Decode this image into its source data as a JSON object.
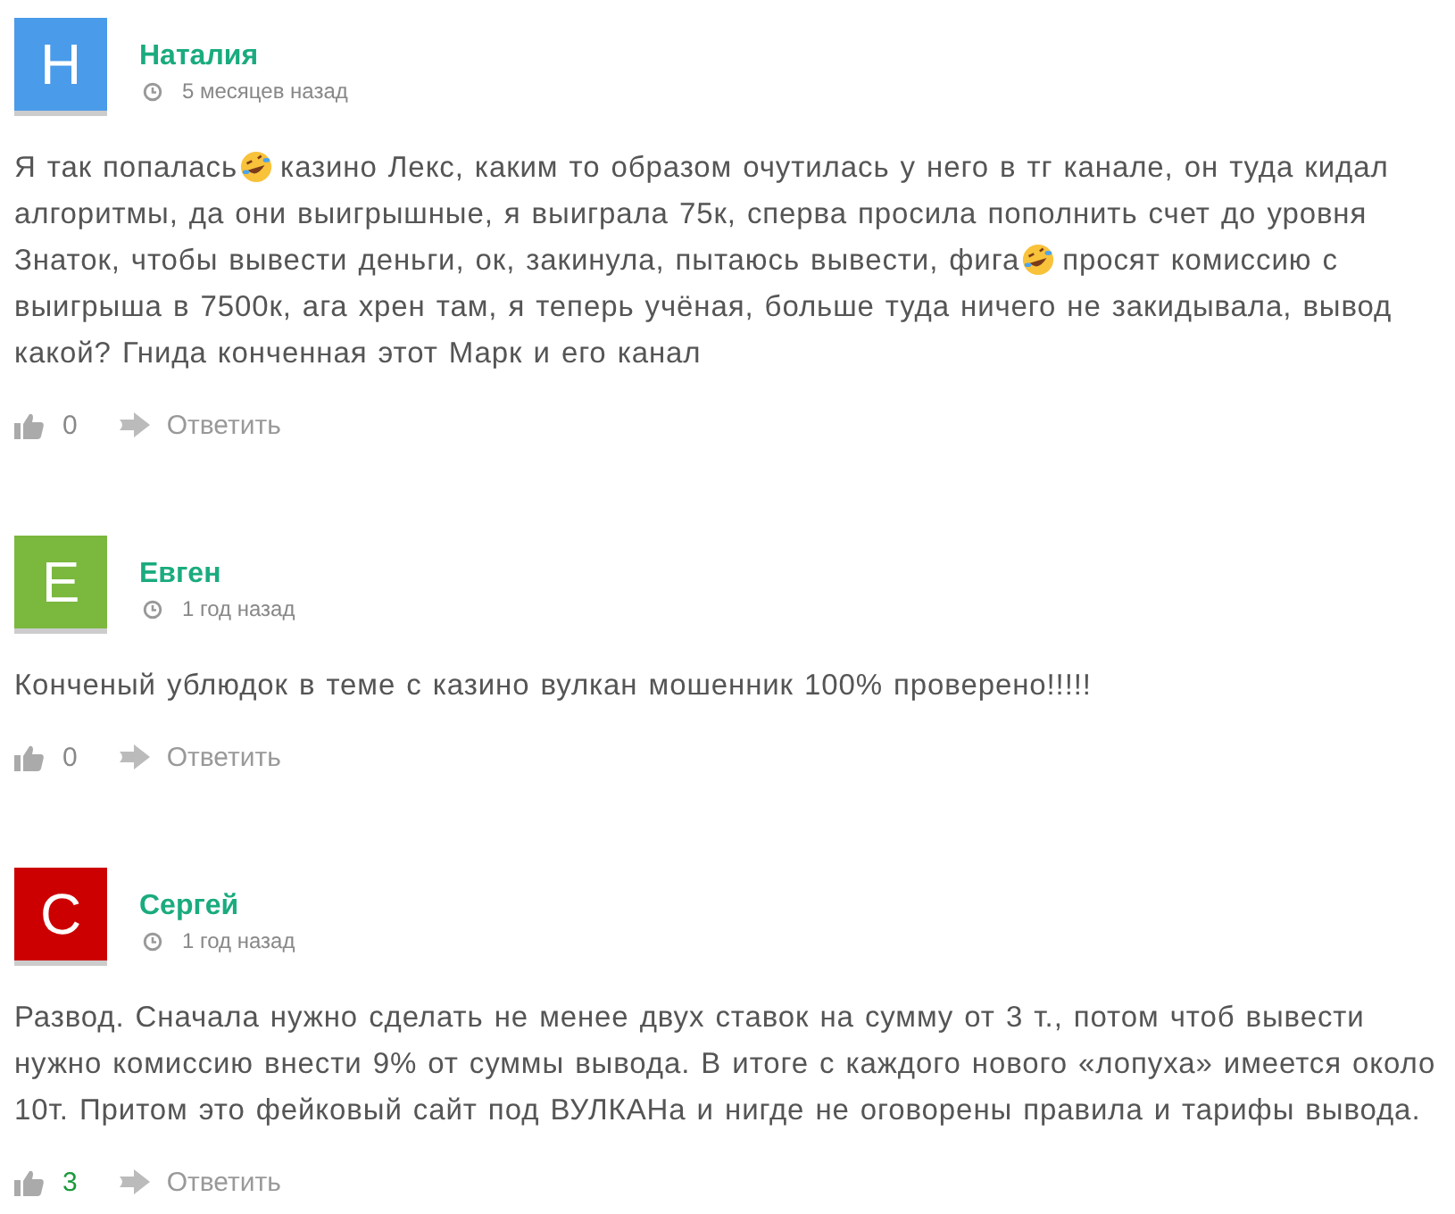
{
  "comments": [
    {
      "initial": "Н",
      "color": "#4a9bea",
      "author": "Наталия",
      "time": "5 месяцев назад",
      "body": [
        {
          "kind": "text",
          "text": "Я так попалась"
        },
        {
          "kind": "emoji"
        },
        {
          "kind": "text",
          "text": "казино Лекс, каким то образом очутилась у него в тг канале, он туда кидал алгоритмы, да они выигрышные, я выиграла 75к, сперва просила пополнить счет до уровня Знаток, чтобы вывести деньги, ок, закинула, пытаюсь вывести, фига"
        },
        {
          "kind": "emoji"
        },
        {
          "kind": "text",
          "text": "просят комиссию с выигрыша в 7500к, ага хрен там, я теперь учёная, больше туда ничего не закидывала, вывод какой? Гнида конченная этот Марк и его канал"
        }
      ],
      "likes": "0",
      "liked": false,
      "reply": "Ответить"
    },
    {
      "initial": "Е",
      "color": "#7ab83e",
      "author": "Евген",
      "time": "1 год назад",
      "body": [
        {
          "kind": "text",
          "text": "Конченый ублюдок в теме с казино вулкан мошенник 100% проверено!!!!!"
        }
      ],
      "likes": "0",
      "liked": false,
      "reply": "Ответить"
    },
    {
      "initial": "С",
      "color": "#cc0000",
      "author": "Сергей",
      "time": "1 год назад",
      "body": [
        {
          "kind": "text",
          "text": "Развод. Сначала нужно сделать не менее двух ставок на сумму от 3 т., потом чтоб вывести нужно комиссию внести 9% от суммы вывода. В итоге с каждого нового «лопуха» имеется около 10т. Притом это фейковый сайт под ВУЛКАНа и нигде не оговорены правила и тарифы вывода."
        }
      ],
      "likes": "3",
      "liked": true,
      "reply": "Ответить"
    }
  ]
}
